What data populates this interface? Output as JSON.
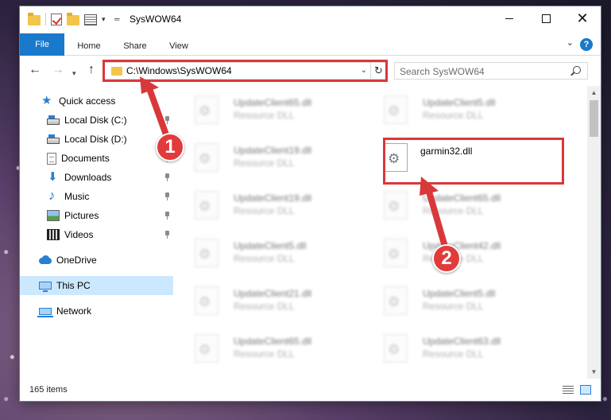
{
  "window": {
    "title": "SysWOW64"
  },
  "ribbon": {
    "tabs": [
      {
        "label": "File"
      },
      {
        "label": "Home"
      },
      {
        "label": "Share"
      },
      {
        "label": "View"
      }
    ],
    "help_label": "?"
  },
  "navigation": {
    "address": "C:\\Windows\\SysWOW64",
    "search_placeholder": "Search SysWOW64"
  },
  "sidebar": {
    "items": [
      {
        "label": "Quick access",
        "icon": "star-icon",
        "pinned": false
      },
      {
        "label": "Local Disk (C:)",
        "icon": "disk-icon",
        "pinned": true
      },
      {
        "label": "Local Disk (D:)",
        "icon": "disk-icon",
        "pinned": false
      },
      {
        "label": "Documents",
        "icon": "documents-icon",
        "pinned": true
      },
      {
        "label": "Downloads",
        "icon": "download-icon",
        "pinned": true
      },
      {
        "label": "Music",
        "icon": "music-icon",
        "pinned": true
      },
      {
        "label": "Pictures",
        "icon": "pictures-icon",
        "pinned": true
      },
      {
        "label": "Videos",
        "icon": "videos-icon",
        "pinned": true
      },
      {
        "label": "OneDrive",
        "icon": "onedrive-icon",
        "pinned": false
      },
      {
        "label": "This PC",
        "icon": "pc-icon",
        "pinned": false,
        "selected": true
      },
      {
        "label": "Network",
        "icon": "network-icon",
        "pinned": false
      }
    ]
  },
  "files": {
    "left_column": [
      {
        "name": "UpdateClient65.dll",
        "type": "Resource DLL"
      },
      {
        "name": "UpdateClient19.dll",
        "type": "Resource DLL"
      },
      {
        "name": "UpdateClient19.dll",
        "type": "Resource DLL"
      },
      {
        "name": "UpdateClient5.dll",
        "type": "Resource DLL"
      },
      {
        "name": "UpdateClient21.dll",
        "type": "Resource DLL"
      },
      {
        "name": "UpdateClient65.dll",
        "type": "Resource DLL"
      }
    ],
    "right_column": [
      {
        "name": "UpdateClient5.dll",
        "type": "Resource DLL"
      },
      {
        "name": "garmin32.dll",
        "type": ""
      },
      {
        "name": "UpdateClient65.dll",
        "type": "Resource DLL"
      },
      {
        "name": "UpdateClient42.dll",
        "type": "Resource DLL"
      },
      {
        "name": "UpdateClient5.dll",
        "type": "Resource DLL"
      },
      {
        "name": "UpdateClient63.dll",
        "type": "Resource DLL"
      }
    ]
  },
  "status": {
    "item_count": "165 items"
  },
  "annotations": {
    "badge_1": "1",
    "badge_2": "2",
    "color": "#d9383a"
  },
  "colors": {
    "accent": "#1979ca",
    "selection": "#cce8ff"
  }
}
